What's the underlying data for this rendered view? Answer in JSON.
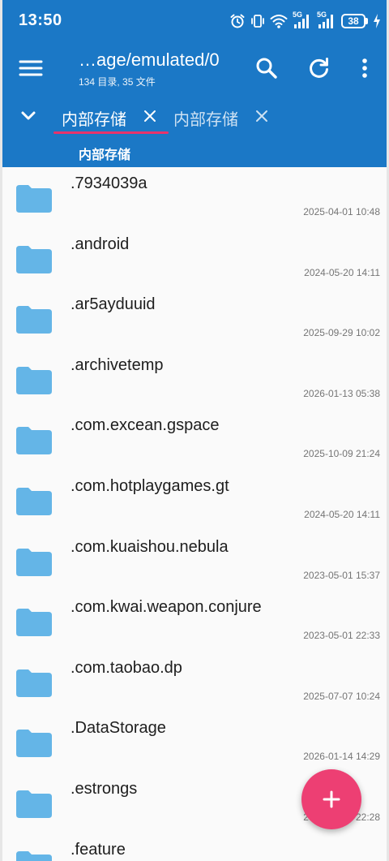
{
  "status_bar": {
    "time": "13:50",
    "battery": "38",
    "network_label_1": "5G",
    "network_label_2": "5G"
  },
  "app_bar": {
    "title": "…age/emulated/0",
    "subtitle": "134 目录, 35 文件",
    "icons": [
      "menu-icon",
      "search-icon",
      "refresh-icon",
      "more-vertical-icon"
    ]
  },
  "tabs": [
    {
      "label": "内部存储",
      "active": true
    },
    {
      "label": "内部存储",
      "active": false
    }
  ],
  "breadcrumb": {
    "label": "内部存储"
  },
  "files": [
    {
      "name": ".7934039a",
      "date": "2025-04-01 10:48"
    },
    {
      "name": ".android",
      "date": "2024-05-20 14:11"
    },
    {
      "name": ".ar5ayduuid",
      "date": "2025-09-29 10:02"
    },
    {
      "name": ".archivetemp",
      "date": "2026-01-13 05:38"
    },
    {
      "name": ".com.excean.gspace",
      "date": "2025-10-09 21:24"
    },
    {
      "name": ".com.hotplaygames.gt",
      "date": "2024-05-20 14:11"
    },
    {
      "name": ".com.kuaishou.nebula",
      "date": "2023-05-01 15:37"
    },
    {
      "name": ".com.kwai.weapon.conjure",
      "date": "2023-05-01 22:33"
    },
    {
      "name": ".com.taobao.dp",
      "date": "2025-07-07 10:24"
    },
    {
      "name": ".DataStorage",
      "date": "2026-01-14 14:29"
    },
    {
      "name": ".estrongs",
      "date": "2025-05-20 22:28"
    },
    {
      "name": ".feature",
      "date": ""
    }
  ],
  "colors": {
    "primary": "#1b78c6",
    "accent": "#ed3f73",
    "tab_indicator": "#e8336b",
    "folder": "#64b5e7",
    "list_background": "#fafafa"
  }
}
